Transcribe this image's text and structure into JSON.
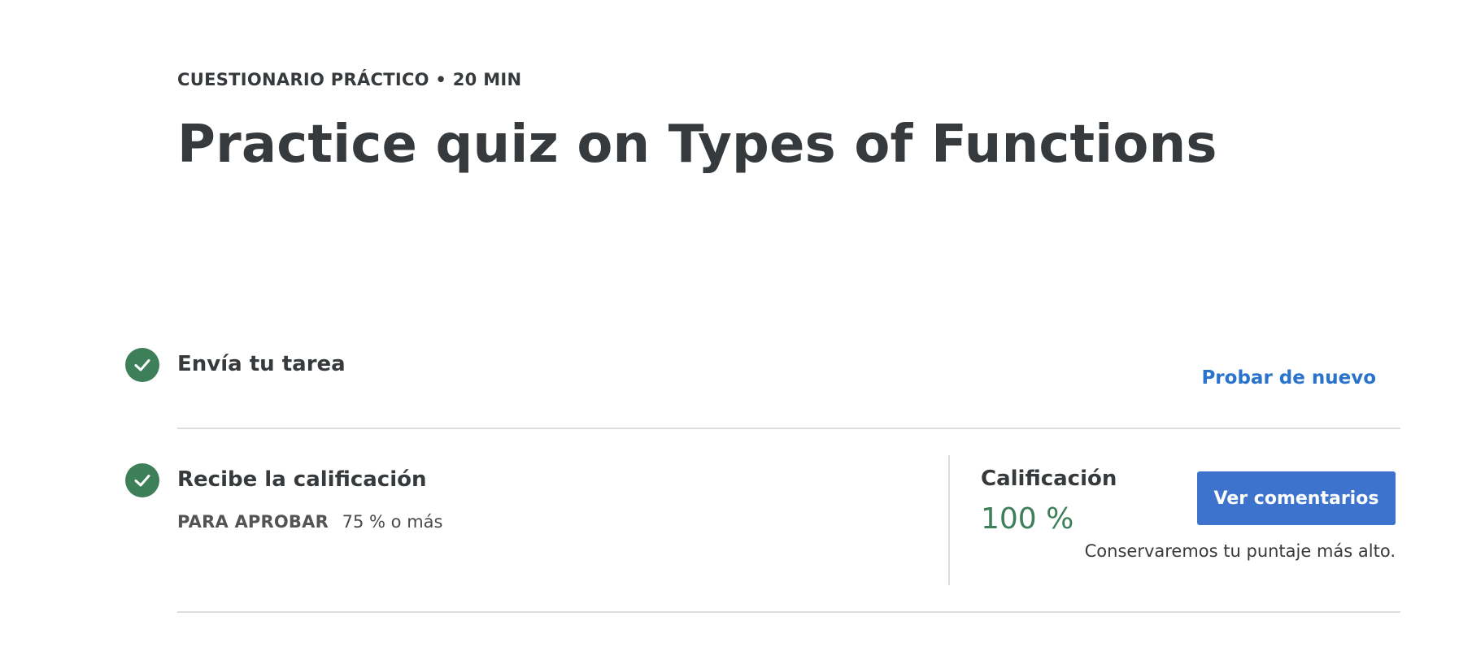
{
  "header": {
    "eyebrow": "CUESTIONARIO PRÁCTICO • 20 MIN",
    "title": "Practice quiz on Types of Functions"
  },
  "steps": [
    {
      "title": "Envía tu tarea",
      "icon": "check-circle-icon",
      "status": "completed",
      "action_label": "Probar de nuevo"
    },
    {
      "title": "Recibe la calificación",
      "icon": "check-circle-icon",
      "status": "completed",
      "pass_label": "PARA APROBAR",
      "pass_value": "75 % o más"
    }
  ],
  "grade": {
    "label": "Calificación",
    "value": "100 %",
    "button_label": "Ver comentarios",
    "note": "Conservaremos tu puntaje más alto."
  },
  "colors": {
    "success": "#3c7f59",
    "link": "#2a73cc",
    "primary_button": "#3d73cc",
    "text": "#373a3c"
  }
}
